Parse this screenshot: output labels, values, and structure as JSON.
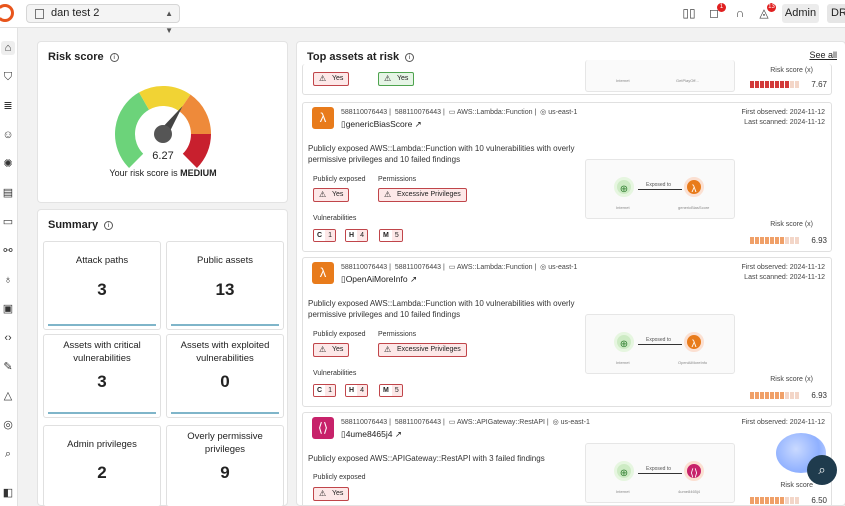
{
  "workspace": {
    "name": "dan test 2"
  },
  "topbar": {
    "notif_badge": "1",
    "alerts_badge": "13",
    "admin_label": "Admin",
    "avatar_initials": "DR"
  },
  "risk_score": {
    "title": "Risk score",
    "value": "6.27",
    "caption_prefix": "Your risk score is ",
    "level": "MEDIUM",
    "level_fraction": 0.63
  },
  "summary": {
    "title": "Summary",
    "cards": [
      {
        "label": "Attack paths",
        "value": "3"
      },
      {
        "label": "Public assets",
        "value": "13"
      },
      {
        "label": "Assets with critical vulnerabilities",
        "value": "3"
      },
      {
        "label": "Assets with exploited vulnerabilities",
        "value": "0"
      },
      {
        "label": "Admin privileges",
        "value": "2"
      },
      {
        "label": "Overly permissive privileges",
        "value": "9"
      }
    ]
  },
  "top_assets": {
    "title": "Top assets at risk",
    "see_all": "See all",
    "partial_top": {
      "tag1": "Yes",
      "tag2": "Yes",
      "risk_label": "Risk score",
      "risk_value": "7.67",
      "graph_left": "Internet",
      "graph_right": "GetPlayOff..."
    },
    "assets": [
      {
        "account1": "588110076443",
        "account2": "588110076443",
        "type": "AWS::Lambda::Function",
        "region": "us-east-1",
        "name": "genericBiasScore",
        "first_observed": "First observed: 2024-11-12",
        "last_scanned": "Last scanned: 2024-11-12",
        "description": "Publicly exposed AWS::Lambda::Function with 10 vulnerabilities with overly permissive privileges and 10 failed findings",
        "exposed_label": "Publicly exposed",
        "exposed_value": "Yes",
        "perm_label": "Permissions",
        "perm_value": "Excessive Privileges",
        "vuln_label": "Vulnerabilities",
        "vuln": [
          {
            "k": "C",
            "n": "1"
          },
          {
            "k": "H",
            "n": "4"
          },
          {
            "k": "M",
            "n": "5"
          }
        ],
        "graph_edge": "Exposed to",
        "graph_left": "Internet",
        "graph_right": "genericBiasScore",
        "risk_label": "Risk score",
        "risk_value": "6.93"
      },
      {
        "account1": "588110076443",
        "account2": "588110076443",
        "type": "AWS::Lambda::Function",
        "region": "us-east-1",
        "name": "OpenAiMoreInfo",
        "first_observed": "First observed: 2024-11-12",
        "last_scanned": "Last scanned: 2024-11-12",
        "description": "Publicly exposed AWS::Lambda::Function with 10 vulnerabilities with overly permissive privileges and 10 failed findings",
        "exposed_label": "Publicly exposed",
        "exposed_value": "Yes",
        "perm_label": "Permissions",
        "perm_value": "Excessive Privileges",
        "vuln_label": "Vulnerabilities",
        "vuln": [
          {
            "k": "C",
            "n": "1"
          },
          {
            "k": "H",
            "n": "4"
          },
          {
            "k": "M",
            "n": "5"
          }
        ],
        "graph_edge": "Exposed to",
        "graph_left": "Internet",
        "graph_right": "OpenAiMoreInfo",
        "risk_label": "Risk score",
        "risk_value": "6.93"
      },
      {
        "account1": "588110076443",
        "account2": "588110076443",
        "type": "AWS::APIGateway::RestAPI",
        "region": "us-east-1",
        "name": "4ume8465j4",
        "first_observed": "First observed: 2024-11-12",
        "last_scanned": "",
        "description": "Publicly exposed AWS::APIGateway::RestAPI with 3 failed findings",
        "exposed_label": "Publicly exposed",
        "exposed_value": "Yes",
        "graph_edge": "Exposed to",
        "graph_left": "Internet",
        "graph_right": "4ume8465j4",
        "risk_label": "Risk score",
        "risk_value": "6.50"
      }
    ]
  },
  "colors": {
    "gauge_green": "#6cd37a",
    "gauge_yellow": "#f1d334",
    "gauge_orange": "#ee8a3a",
    "gauge_red": "#c8202e",
    "lambda": "#e87b1b",
    "apigw": "#c7226a",
    "risk_bar": "#f0a068",
    "risk_bar_high": "#d23a3a"
  },
  "icons": {
    "notif": "chat-bubble-icon",
    "alerts": "bell-icon",
    "help": "headset-icon",
    "docs": "book-icon"
  }
}
